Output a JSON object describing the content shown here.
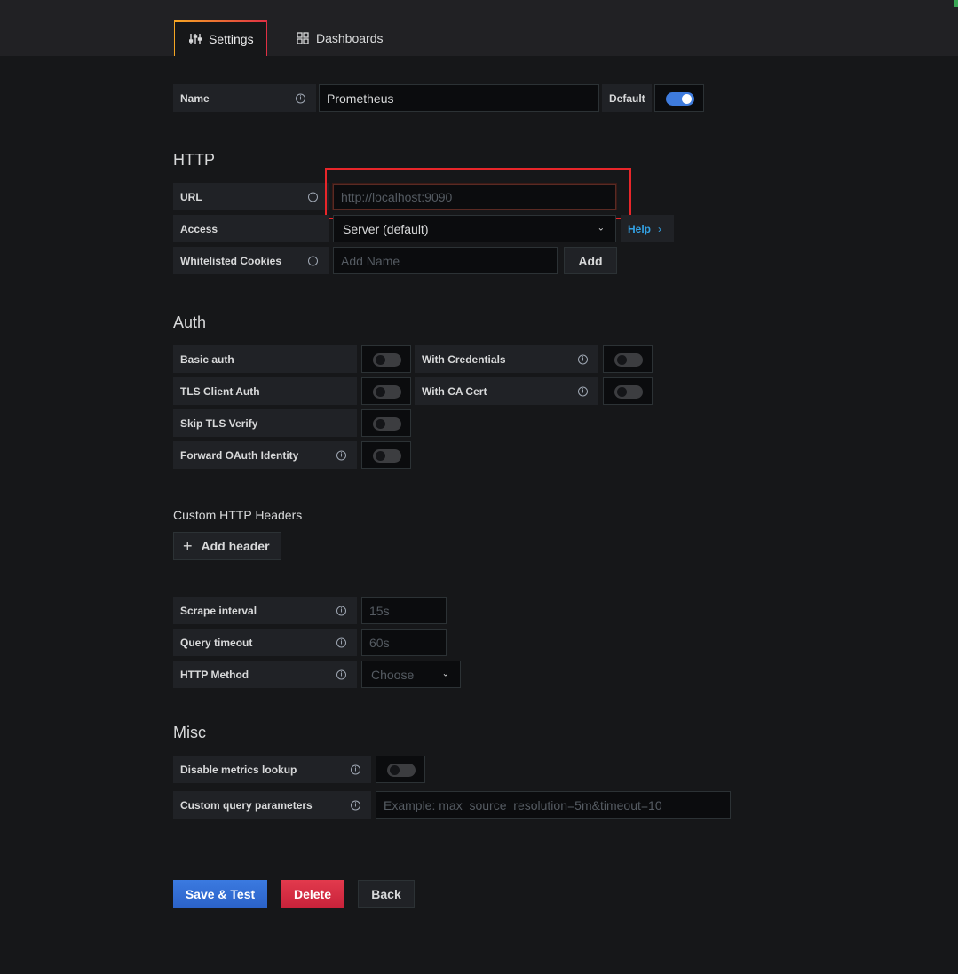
{
  "tabs": [
    {
      "label": "Settings",
      "icon": "sliders-icon",
      "active": true
    },
    {
      "label": "Dashboards",
      "icon": "grid-icon",
      "active": false
    }
  ],
  "name_row": {
    "label": "Name",
    "value": "Prometheus",
    "default_label": "Default",
    "default_on": true
  },
  "http": {
    "title": "HTTP",
    "url_label": "URL",
    "url_placeholder": "http://localhost:9090",
    "access_label": "Access",
    "access_value": "Server (default)",
    "help_label": "Help",
    "cookies_label": "Whitelisted Cookies",
    "cookies_placeholder": "Add Name",
    "add_label": "Add"
  },
  "auth": {
    "title": "Auth",
    "basic_auth": "Basic auth",
    "with_credentials": "With Credentials",
    "tls_client_auth": "TLS Client Auth",
    "with_ca_cert": "With CA Cert",
    "skip_tls": "Skip TLS Verify",
    "forward_oauth": "Forward OAuth Identity"
  },
  "headers": {
    "title": "Custom HTTP Headers",
    "add_header": "Add header"
  },
  "prom": {
    "scrape_label": "Scrape interval",
    "scrape_placeholder": "15s",
    "timeout_label": "Query timeout",
    "timeout_placeholder": "60s",
    "method_label": "HTTP Method",
    "method_placeholder": "Choose"
  },
  "misc": {
    "title": "Misc",
    "disable_metrics": "Disable metrics lookup",
    "custom_params": "Custom query parameters",
    "custom_params_placeholder": "Example: max_source_resolution=5m&timeout=10"
  },
  "actions": {
    "save": "Save & Test",
    "delete": "Delete",
    "back": "Back"
  },
  "colors": {
    "primary": "#3871dc",
    "danger": "#e02f44",
    "highlight": "#e8262a"
  }
}
